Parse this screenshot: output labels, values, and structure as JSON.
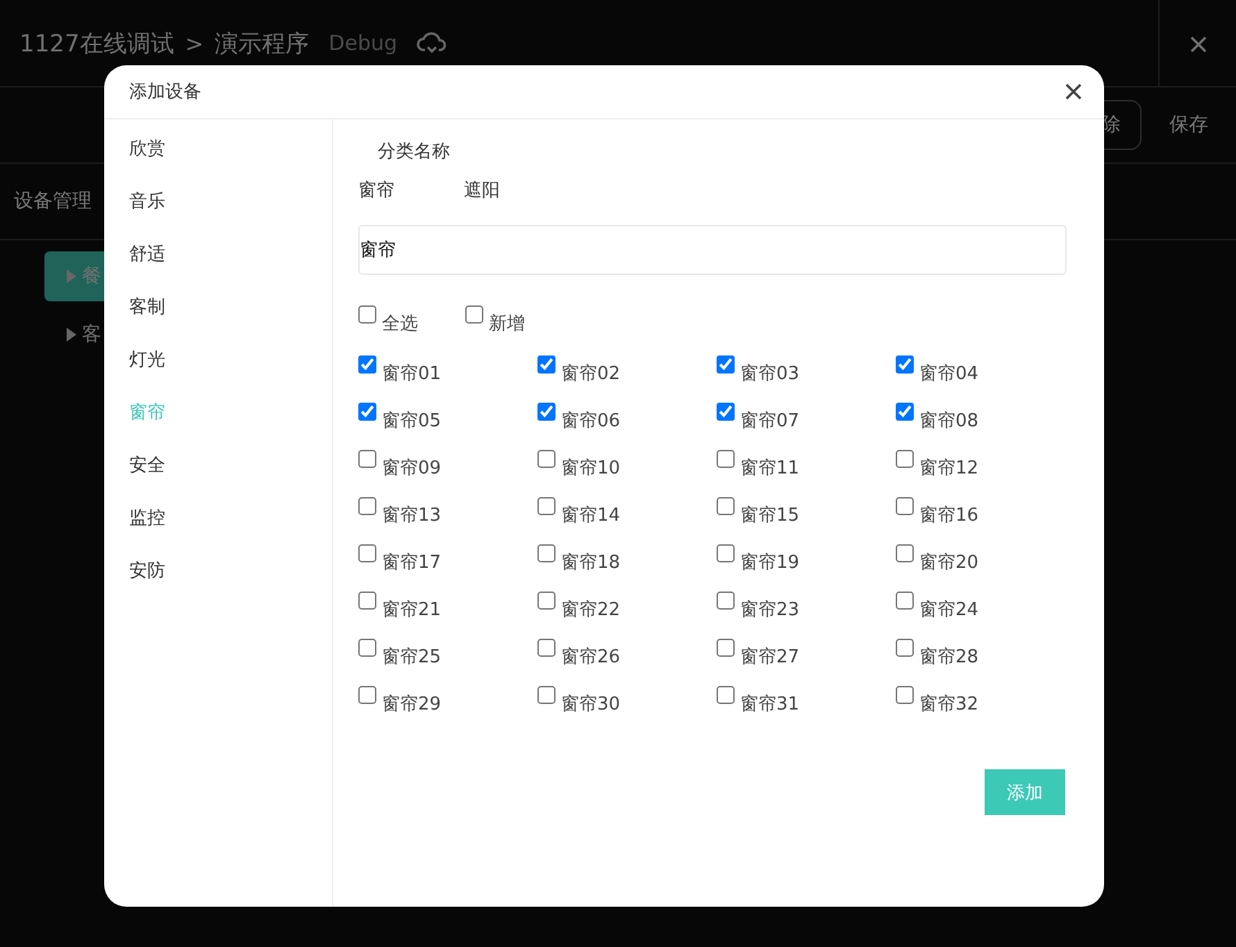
{
  "app": {
    "breadcrumb": [
      "1127在线调试",
      "演示程序"
    ],
    "separator": ">",
    "mode": "Debug",
    "toolbar_buttons": [
      "除",
      "保存"
    ],
    "section_title": "设备管理",
    "tree": [
      {
        "label": "餐",
        "selected": true
      },
      {
        "label": "客",
        "selected": false
      }
    ]
  },
  "dialog": {
    "title": "添加设备",
    "menu": [
      {
        "label": "欣赏",
        "selected": false
      },
      {
        "label": "音乐",
        "selected": false
      },
      {
        "label": "舒适",
        "selected": false
      },
      {
        "label": "客制",
        "selected": false
      },
      {
        "label": "灯光",
        "selected": false
      },
      {
        "label": "窗帘",
        "selected": true
      },
      {
        "label": "安全",
        "selected": false
      },
      {
        "label": "监控",
        "selected": false
      },
      {
        "label": "安防",
        "selected": false
      }
    ],
    "category_label": "分类名称",
    "categories": [
      "窗帘",
      "遮阳"
    ],
    "name_field": {
      "value": "窗帘"
    },
    "select_all": {
      "label": "全选",
      "checked": false
    },
    "add_new": {
      "label": "新增",
      "checked": false
    },
    "devices": [
      {
        "label": "窗帘01",
        "checked": true
      },
      {
        "label": "窗帘02",
        "checked": true
      },
      {
        "label": "窗帘03",
        "checked": true
      },
      {
        "label": "窗帘04",
        "checked": true
      },
      {
        "label": "窗帘05",
        "checked": true
      },
      {
        "label": "窗帘06",
        "checked": true
      },
      {
        "label": "窗帘07",
        "checked": true
      },
      {
        "label": "窗帘08",
        "checked": true
      },
      {
        "label": "窗帘09",
        "checked": false
      },
      {
        "label": "窗帘10",
        "checked": false
      },
      {
        "label": "窗帘11",
        "checked": false
      },
      {
        "label": "窗帘12",
        "checked": false
      },
      {
        "label": "窗帘13",
        "checked": false
      },
      {
        "label": "窗帘14",
        "checked": false
      },
      {
        "label": "窗帘15",
        "checked": false
      },
      {
        "label": "窗帘16",
        "checked": false
      },
      {
        "label": "窗帘17",
        "checked": false
      },
      {
        "label": "窗帘18",
        "checked": false
      },
      {
        "label": "窗帘19",
        "checked": false
      },
      {
        "label": "窗帘20",
        "checked": false
      },
      {
        "label": "窗帘21",
        "checked": false
      },
      {
        "label": "窗帘22",
        "checked": false
      },
      {
        "label": "窗帘23",
        "checked": false
      },
      {
        "label": "窗帘24",
        "checked": false
      },
      {
        "label": "窗帘25",
        "checked": false
      },
      {
        "label": "窗帘26",
        "checked": false
      },
      {
        "label": "窗帘27",
        "checked": false
      },
      {
        "label": "窗帘28",
        "checked": false
      },
      {
        "label": "窗帘29",
        "checked": false
      },
      {
        "label": "窗帘30",
        "checked": false
      },
      {
        "label": "窗帘31",
        "checked": false
      },
      {
        "label": "窗帘32",
        "checked": false
      }
    ],
    "submit": "添加"
  }
}
